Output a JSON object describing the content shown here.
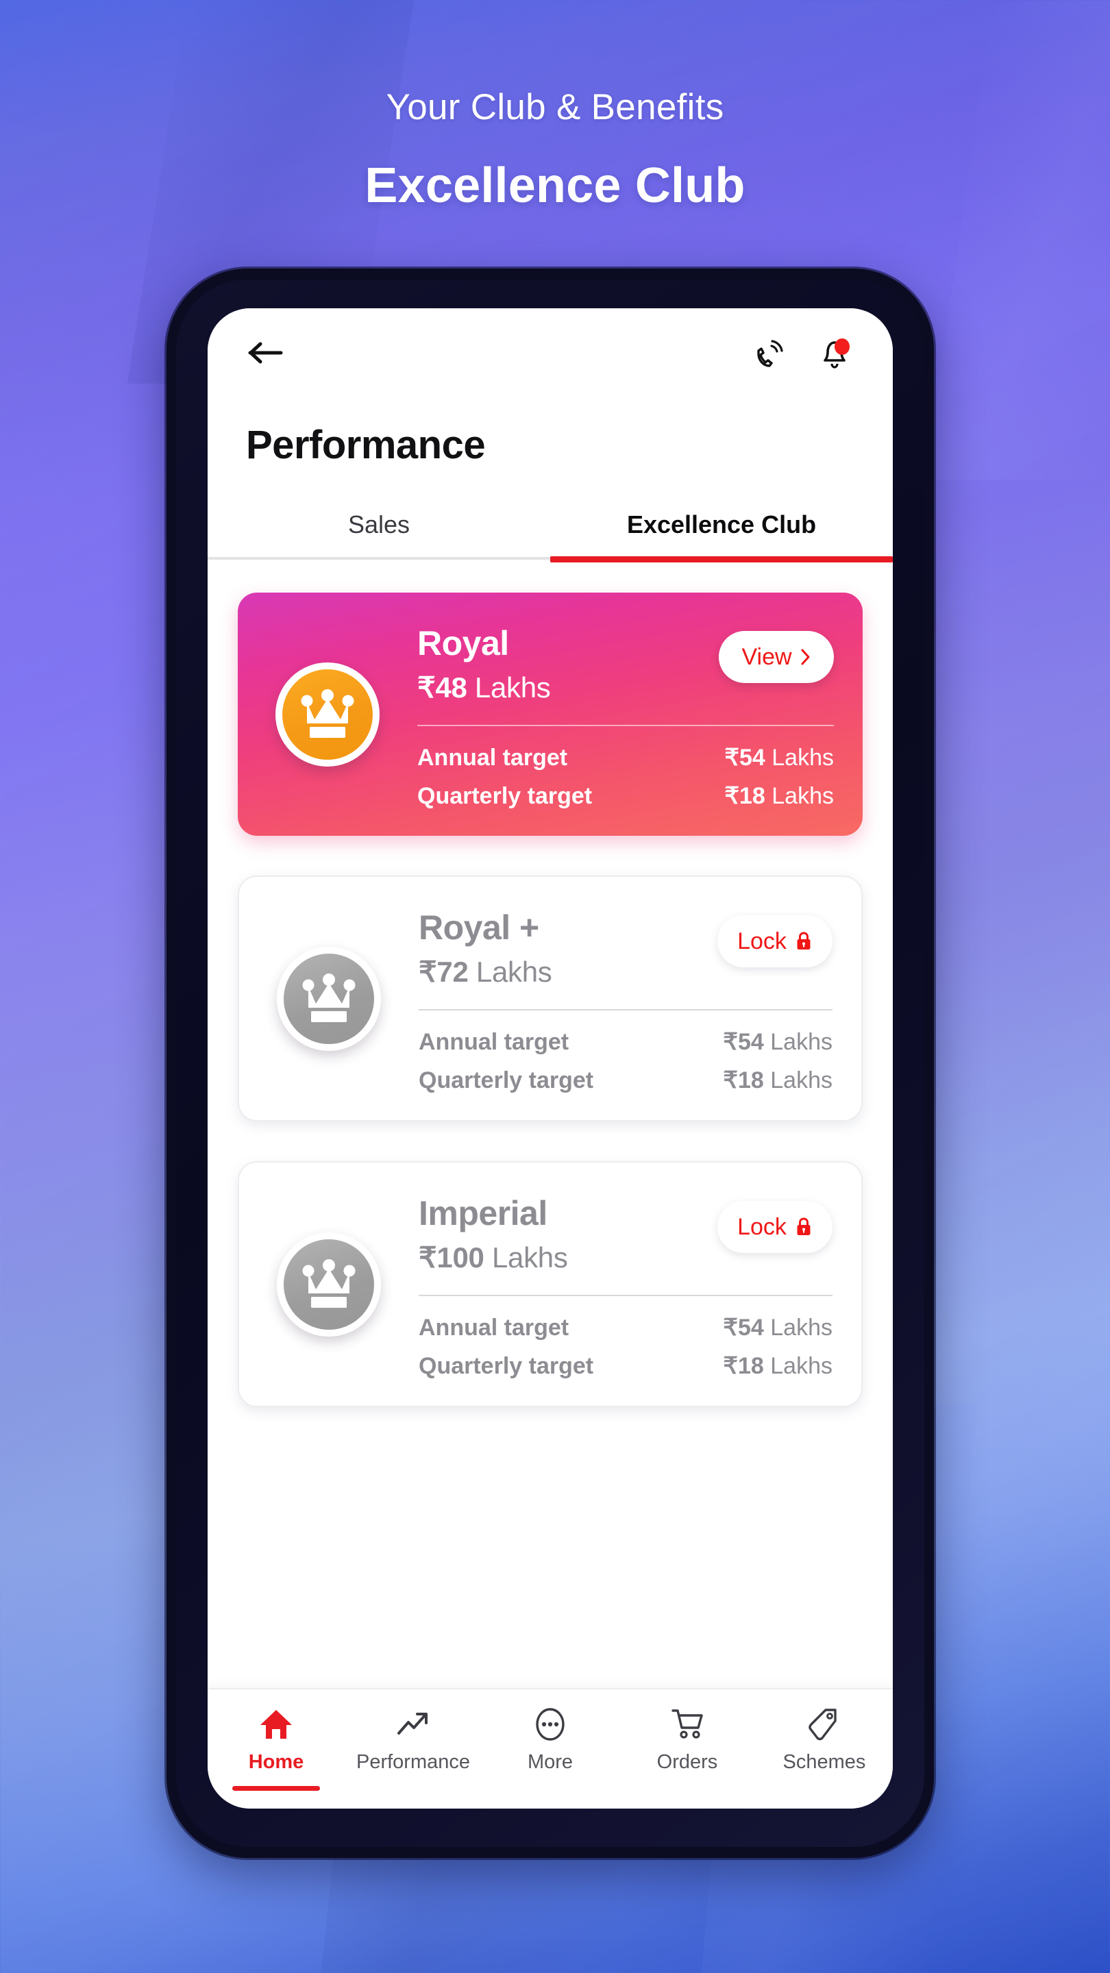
{
  "promo": {
    "subtitle": "Your Club & Benefits",
    "title": "Excellence Club"
  },
  "app": {
    "back_icon": "back-arrow-icon",
    "call_icon": "phone-ring-icon",
    "bell_icon": "notification-bell-icon",
    "page_title": "Performance"
  },
  "tabs": [
    {
      "label": "Sales",
      "active": false
    },
    {
      "label": "Excellence Club",
      "active": true
    }
  ],
  "colors": {
    "accent_red": "#e81b23",
    "featured_gradient_start": "#d839b6",
    "featured_gradient_end": "#f86a63",
    "badge_gold": "#f59a17",
    "badge_grey": "#9d9d9d",
    "locked_text": "#8c8c92"
  },
  "targets_header": {
    "annual_label": "Annual target",
    "quarterly_label": "Quarterly target"
  },
  "cards": [
    {
      "name": "Royal",
      "amount_currency": "₹",
      "amount_number": "48",
      "amount_unit": " Lakhs",
      "state": "unlocked",
      "action_label": "View",
      "action_icon": "chevron-right-icon",
      "badge_icon": "crown-icon",
      "annual_label": "Annual target",
      "annual_currency": "₹",
      "annual_number": "54",
      "annual_unit": " Lakhs",
      "quarterly_label": "Quarterly target",
      "quarterly_currency": "₹",
      "quarterly_number": "18",
      "quarterly_unit": " Lakhs"
    },
    {
      "name": "Royal +",
      "amount_currency": "₹",
      "amount_number": "72",
      "amount_unit": " Lakhs",
      "state": "locked",
      "action_label": "Lock",
      "action_icon": "lock-icon",
      "badge_icon": "crown-icon",
      "annual_label": "Annual target",
      "annual_currency": "₹",
      "annual_number": "54",
      "annual_unit": " Lakhs",
      "quarterly_label": "Quarterly target",
      "quarterly_currency": "₹",
      "quarterly_number": "18",
      "quarterly_unit": " Lakhs"
    },
    {
      "name": "Imperial",
      "amount_currency": "₹",
      "amount_number": "100",
      "amount_unit": " Lakhs",
      "state": "locked",
      "action_label": "Lock",
      "action_icon": "lock-icon",
      "badge_icon": "crown-icon",
      "annual_label": "Annual target",
      "annual_currency": "₹",
      "annual_number": "54",
      "annual_unit": " Lakhs",
      "quarterly_label": "Quarterly target",
      "quarterly_currency": "₹",
      "quarterly_number": "18",
      "quarterly_unit": " Lakhs"
    }
  ],
  "bottom_nav": [
    {
      "label": "Home",
      "icon": "home-icon",
      "active": true
    },
    {
      "label": "Performance",
      "icon": "trending-up-icon",
      "active": false
    },
    {
      "label": "More",
      "icon": "more-dots-icon",
      "active": false
    },
    {
      "label": "Orders",
      "icon": "shopping-cart-icon",
      "active": false
    },
    {
      "label": "Schemes",
      "icon": "tag-icon",
      "active": false
    }
  ]
}
